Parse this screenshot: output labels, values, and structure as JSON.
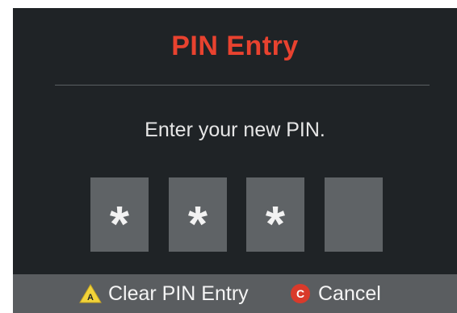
{
  "dialog": {
    "title": "PIN Entry",
    "prompt": "Enter your new PIN."
  },
  "pin": {
    "slots": [
      "*",
      "*",
      "*",
      ""
    ],
    "entered_count": 3,
    "total_slots": 4
  },
  "footer": {
    "clear": {
      "key": "A",
      "label": "Clear PIN Entry",
      "icon": "a-button-triangle-icon"
    },
    "cancel": {
      "key": "C",
      "label": "Cancel",
      "icon": "c-button-circle-icon"
    }
  },
  "colors": {
    "background": "#1f2326",
    "title": "#e8422f",
    "pin_box": "#5f6366",
    "footer": "#5a5d60",
    "a_button": "#f2d33a",
    "c_button": "#d93a2b"
  }
}
